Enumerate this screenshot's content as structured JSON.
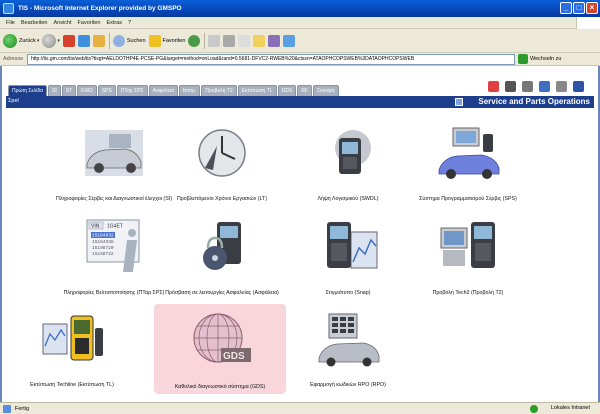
{
  "window": {
    "title": "TIS - Microsoft Internet Explorer provided by GMSPO"
  },
  "menu": [
    "File",
    "Bearbeiten",
    "Ansicht",
    "Favoriten",
    "Extras",
    "?"
  ],
  "toolbar": {
    "back": "Zurück",
    "search": "Suchen",
    "favorites": "Favoriten"
  },
  "address": {
    "label": "Adresse",
    "url": "http://tis.gm.com/tis/web/tis?tisgt=AELDOTHP4E-PCSE-PG&target=method=onLoad&rand=0.5681-DFVC2-RWEB%20&ctssn=ATAOPHCOPSWEB%3DATAOPHCOPSWEB",
    "go": "Wechseln zu"
  },
  "tabs": [
    "Πρώτη Σελίδα",
    "SI",
    "ST",
    "EWD",
    "SPS",
    "ΠΤαρ ΣΡΣ",
    "Ασφάλεια",
    "Ιστορ.",
    "Προβολή T2",
    "Εκτύπωση TL",
    "GDS",
    "RF",
    "Σύνοψη"
  ],
  "active_tab": "Πρώτη Σελίδα",
  "breadcrumb": "Σpel",
  "header": {
    "title": "Service and Parts Operations"
  },
  "tiles": [
    {
      "label": "Πληροφορίες Σέρβις και Διαγνωστικοί έλεγχοι (SI)",
      "icon": "car-service-icon",
      "highlight": false
    },
    {
      "label": "Προβλεπόμενοι Χρόνοι Εργασιών (LT)",
      "icon": "labor-time-clock-icon",
      "highlight": false
    },
    {
      "label": "Λήψη Λογισμικού (SWDL)",
      "icon": "scan-tool-download-icon",
      "highlight": false
    },
    {
      "label": "Σύστημα Προγραμματισμού Σέρβις (SPS)",
      "icon": "programming-car-icon",
      "highlight": false
    },
    {
      "label": "Πληροφορίες Βελτιστοποίησης (ΠΤαρ ΣΡΣ)",
      "icon": "vin-info-icon",
      "highlight": false
    },
    {
      "label": "Πρόσβαση σε λειτουργίες Ασφαλείας (Ασφάλεια)",
      "icon": "security-lock-icon",
      "highlight": false
    },
    {
      "label": "Στιγμιότυπο (Snap)",
      "icon": "snapshot-icon",
      "highlight": false
    },
    {
      "label": "Προβολή Tech2 (Προβολή T2)",
      "icon": "tech2-view-icon",
      "highlight": false
    },
    {
      "label": "Εκτύπωση Techline (Εκτύπωση TL)",
      "icon": "techline-print-icon",
      "highlight": false
    },
    {
      "label": "Καθολικό διαγνωστικό σύστημα (GDS)",
      "icon": "gds-globe-icon",
      "highlight": true
    },
    {
      "label": "Εφαρμογή κωδικών RPO (RPO)",
      "icon": "rpo-car-icon",
      "highlight": false
    }
  ],
  "gds_badge": "GDS",
  "vin_card": {
    "label": "VIN",
    "code": "1G4ET",
    "lines": [
      "15184932",
      "15184938",
      "15198720",
      "15198722"
    ]
  },
  "status": {
    "text": "Fertig",
    "zone": "Lokales Intranet"
  },
  "colors": {
    "tab_active": "#1d3e8c",
    "tab_inactive": "#a9b0bd",
    "title_bar": "#0747b8",
    "highlight": "#f8d6dc"
  }
}
